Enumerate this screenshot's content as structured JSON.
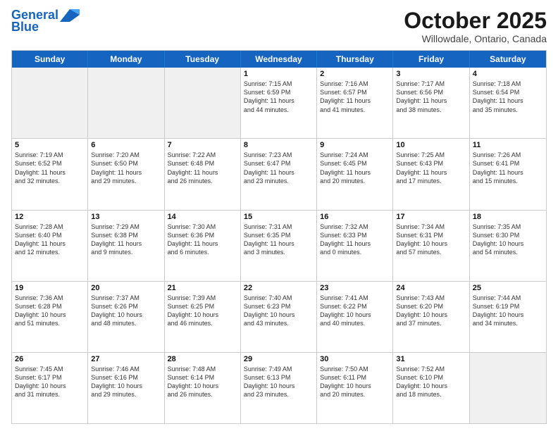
{
  "header": {
    "logo_line1": "General",
    "logo_line2": "Blue",
    "month_title": "October 2025",
    "location": "Willowdale, Ontario, Canada"
  },
  "weekdays": [
    "Sunday",
    "Monday",
    "Tuesday",
    "Wednesday",
    "Thursday",
    "Friday",
    "Saturday"
  ],
  "rows": [
    [
      {
        "day": "",
        "info": ""
      },
      {
        "day": "",
        "info": ""
      },
      {
        "day": "",
        "info": ""
      },
      {
        "day": "1",
        "info": "Sunrise: 7:15 AM\nSunset: 6:59 PM\nDaylight: 11 hours\nand 44 minutes."
      },
      {
        "day": "2",
        "info": "Sunrise: 7:16 AM\nSunset: 6:57 PM\nDaylight: 11 hours\nand 41 minutes."
      },
      {
        "day": "3",
        "info": "Sunrise: 7:17 AM\nSunset: 6:56 PM\nDaylight: 11 hours\nand 38 minutes."
      },
      {
        "day": "4",
        "info": "Sunrise: 7:18 AM\nSunset: 6:54 PM\nDaylight: 11 hours\nand 35 minutes."
      }
    ],
    [
      {
        "day": "5",
        "info": "Sunrise: 7:19 AM\nSunset: 6:52 PM\nDaylight: 11 hours\nand 32 minutes."
      },
      {
        "day": "6",
        "info": "Sunrise: 7:20 AM\nSunset: 6:50 PM\nDaylight: 11 hours\nand 29 minutes."
      },
      {
        "day": "7",
        "info": "Sunrise: 7:22 AM\nSunset: 6:48 PM\nDaylight: 11 hours\nand 26 minutes."
      },
      {
        "day": "8",
        "info": "Sunrise: 7:23 AM\nSunset: 6:47 PM\nDaylight: 11 hours\nand 23 minutes."
      },
      {
        "day": "9",
        "info": "Sunrise: 7:24 AM\nSunset: 6:45 PM\nDaylight: 11 hours\nand 20 minutes."
      },
      {
        "day": "10",
        "info": "Sunrise: 7:25 AM\nSunset: 6:43 PM\nDaylight: 11 hours\nand 17 minutes."
      },
      {
        "day": "11",
        "info": "Sunrise: 7:26 AM\nSunset: 6:41 PM\nDaylight: 11 hours\nand 15 minutes."
      }
    ],
    [
      {
        "day": "12",
        "info": "Sunrise: 7:28 AM\nSunset: 6:40 PM\nDaylight: 11 hours\nand 12 minutes."
      },
      {
        "day": "13",
        "info": "Sunrise: 7:29 AM\nSunset: 6:38 PM\nDaylight: 11 hours\nand 9 minutes."
      },
      {
        "day": "14",
        "info": "Sunrise: 7:30 AM\nSunset: 6:36 PM\nDaylight: 11 hours\nand 6 minutes."
      },
      {
        "day": "15",
        "info": "Sunrise: 7:31 AM\nSunset: 6:35 PM\nDaylight: 11 hours\nand 3 minutes."
      },
      {
        "day": "16",
        "info": "Sunrise: 7:32 AM\nSunset: 6:33 PM\nDaylight: 11 hours\nand 0 minutes."
      },
      {
        "day": "17",
        "info": "Sunrise: 7:34 AM\nSunset: 6:31 PM\nDaylight: 10 hours\nand 57 minutes."
      },
      {
        "day": "18",
        "info": "Sunrise: 7:35 AM\nSunset: 6:30 PM\nDaylight: 10 hours\nand 54 minutes."
      }
    ],
    [
      {
        "day": "19",
        "info": "Sunrise: 7:36 AM\nSunset: 6:28 PM\nDaylight: 10 hours\nand 51 minutes."
      },
      {
        "day": "20",
        "info": "Sunrise: 7:37 AM\nSunset: 6:26 PM\nDaylight: 10 hours\nand 48 minutes."
      },
      {
        "day": "21",
        "info": "Sunrise: 7:39 AM\nSunset: 6:25 PM\nDaylight: 10 hours\nand 46 minutes."
      },
      {
        "day": "22",
        "info": "Sunrise: 7:40 AM\nSunset: 6:23 PM\nDaylight: 10 hours\nand 43 minutes."
      },
      {
        "day": "23",
        "info": "Sunrise: 7:41 AM\nSunset: 6:22 PM\nDaylight: 10 hours\nand 40 minutes."
      },
      {
        "day": "24",
        "info": "Sunrise: 7:43 AM\nSunset: 6:20 PM\nDaylight: 10 hours\nand 37 minutes."
      },
      {
        "day": "25",
        "info": "Sunrise: 7:44 AM\nSunset: 6:19 PM\nDaylight: 10 hours\nand 34 minutes."
      }
    ],
    [
      {
        "day": "26",
        "info": "Sunrise: 7:45 AM\nSunset: 6:17 PM\nDaylight: 10 hours\nand 31 minutes."
      },
      {
        "day": "27",
        "info": "Sunrise: 7:46 AM\nSunset: 6:16 PM\nDaylight: 10 hours\nand 29 minutes."
      },
      {
        "day": "28",
        "info": "Sunrise: 7:48 AM\nSunset: 6:14 PM\nDaylight: 10 hours\nand 26 minutes."
      },
      {
        "day": "29",
        "info": "Sunrise: 7:49 AM\nSunset: 6:13 PM\nDaylight: 10 hours\nand 23 minutes."
      },
      {
        "day": "30",
        "info": "Sunrise: 7:50 AM\nSunset: 6:11 PM\nDaylight: 10 hours\nand 20 minutes."
      },
      {
        "day": "31",
        "info": "Sunrise: 7:52 AM\nSunset: 6:10 PM\nDaylight: 10 hours\nand 18 minutes."
      },
      {
        "day": "",
        "info": ""
      }
    ]
  ]
}
